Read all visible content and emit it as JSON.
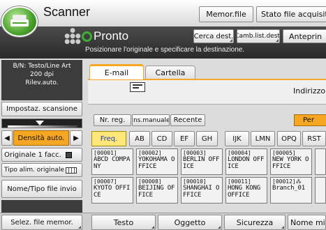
{
  "app": {
    "title": "Scanner"
  },
  "top_buttons": {
    "memor_file": "Memor.file",
    "stato": "Stato file acquisit"
  },
  "header": {
    "title": "Pronto",
    "subtitle": "Posizionare l'originale e specificare la destinazione."
  },
  "dest_buttons": {
    "cerca": "Cerca dest.",
    "camb": "Camb.list.dest.",
    "anteprima": "Anteprin"
  },
  "sidebar": {
    "scan_info_line1": "B/N: Testo/Line Art",
    "scan_info_line2": "200 dpi",
    "scan_info_line3": "Rilev.auto.",
    "impostaz": "Impostaz. scansione",
    "density_label": "Densità auto.",
    "originale": "Originale 1 facc.",
    "tipo_alim": "Tipo alim. originale",
    "nome_tipo": "Nome/Tipo file invio"
  },
  "tabs": {
    "email": "E-mail",
    "cartella": "Cartella"
  },
  "dest_field": {
    "address_label": "Indirizzo e"
  },
  "entry_buttons": {
    "nr_reg": "Nr. reg.",
    "ins_manuale": "Ins.manuale",
    "recente": "Recente",
    "per": "Per"
  },
  "index_tabs": [
    "Freq.",
    "AB",
    "CD",
    "EF",
    "GH",
    "IJK",
    "LMN",
    "OPQ",
    "RST"
  ],
  "destinations": [
    {
      "num": "[00001]",
      "name": "ABCD COMPANY"
    },
    {
      "num": "[00002]",
      "name": "YOKOHAMA OFFICE"
    },
    {
      "num": "[00003]",
      "name": "BERLIN OFFICE"
    },
    {
      "num": "[00004]",
      "name": "LONDON OFFICE"
    },
    {
      "num": "[00005]",
      "name": "NEW YORK OFFICE"
    },
    {
      "num": "[00007]",
      "name": "KYOTO OFFICE"
    },
    {
      "num": "[00008]",
      "name": "BEIJING OFFICE"
    },
    {
      "num": "[00010]",
      "name": "SHANGHAI OFFICE"
    },
    {
      "num": "[00011]",
      "name": "HONG KONG OFFICE"
    },
    {
      "num": "[00012]",
      "group_mark": "⁂",
      "name": "Branch_01"
    }
  ],
  "bottom": {
    "selez": "Selez. file memor.",
    "testo": "Testo",
    "oggetto": "Oggetto",
    "sicurezza": "Sicurezza",
    "nome_mitt": "Nome mitt"
  },
  "colors": {
    "accent_orange": "#f5a623",
    "ready_green": "#3cb034",
    "active_yellow": "#ffe77a",
    "dark_sidebar": "#3c3c3c"
  }
}
